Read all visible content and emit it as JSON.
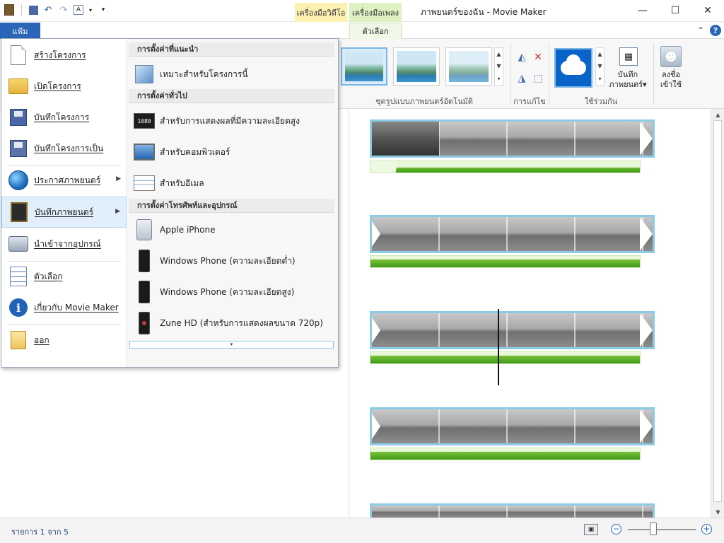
{
  "window": {
    "title": "ภาพยนตร์ของฉัน - Movie Maker",
    "minimize": "—",
    "maximize": "☐",
    "close": "✕"
  },
  "quick_access": {
    "app_icon": "film-icon",
    "save": "save-icon",
    "undo": "undo-icon",
    "redo": "redo-icon",
    "font_tool": "font-icon"
  },
  "context_tabs": {
    "video_tools": "เครื่องมือวิดีโอ",
    "music_tools": "เครื่องมือเพลง"
  },
  "ribbon": {
    "file_tab": "แฟ้ม",
    "options_tab": "ตัวเลือก",
    "groups": {
      "automovie": "ชุดรูปแบบภาพยนตร์อัตโนมัติ",
      "editing": "การแก้ไข",
      "share": "ใช้ร่วมกัน"
    },
    "save_movie_label_1": "บันทึก",
    "save_movie_label_2": "ภาพยนตร์▾",
    "signin_label_1": "ลงชื่อ",
    "signin_label_2": "เข้าใช้"
  },
  "file_menu": {
    "items": [
      {
        "label": "สร้างโครงการ",
        "icon": "new-project-icon"
      },
      {
        "label": "เปิดโครงการ",
        "icon": "open-folder-icon"
      },
      {
        "label": "บันทึกโครงการ",
        "icon": "save-project-icon"
      },
      {
        "label": "บันทึกโครงการเป็น",
        "icon": "save-as-icon"
      },
      {
        "label": "ประกาศภาพยนตร์",
        "icon": "publish-globe-icon"
      },
      {
        "label": "บันทึกภาพยนตร์",
        "icon": "save-movie-icon"
      },
      {
        "label": "นำเข้าจากอุปกรณ์",
        "icon": "import-device-icon"
      },
      {
        "label": "ตัวเลือก",
        "icon": "options-checklist-icon"
      },
      {
        "label": "เกี่ยวกับ Movie Maker",
        "icon": "info-icon"
      },
      {
        "label": "ออก",
        "icon": "exit-icon"
      }
    ],
    "submenu": {
      "recommended_header": "การตั้งค่าที่แนะนำ",
      "recommended_item": "เหมาะสำหรับโครงการนี้",
      "common_header": "การตั้งค่าทั่วไป",
      "common_items": [
        "สำหรับการแสดงผลที่มีความละเอียดสูง",
        "สำหรับคอมพิวเตอร์",
        "สำหรับอีเมล"
      ],
      "device_header": "การตั้งค่าโทรศัพท์และอุปกรณ์",
      "device_items": [
        "Apple iPhone",
        "Windows Phone (ความละเอียดต่ำ)",
        "Windows Phone (ความละเอียดสูง)",
        "Zune HD (สำหรับการแสดงผลขนาด 720p)"
      ],
      "hd_badge": "1080",
      "more_arrow": "▾"
    }
  },
  "status": {
    "item_count": "รายการ 1 จาก 5",
    "zoom_level": 0.38
  },
  "colors": {
    "accent": "#2a65b7",
    "clip_border": "#8ccbe8",
    "audio_green": "#3f9a17"
  }
}
